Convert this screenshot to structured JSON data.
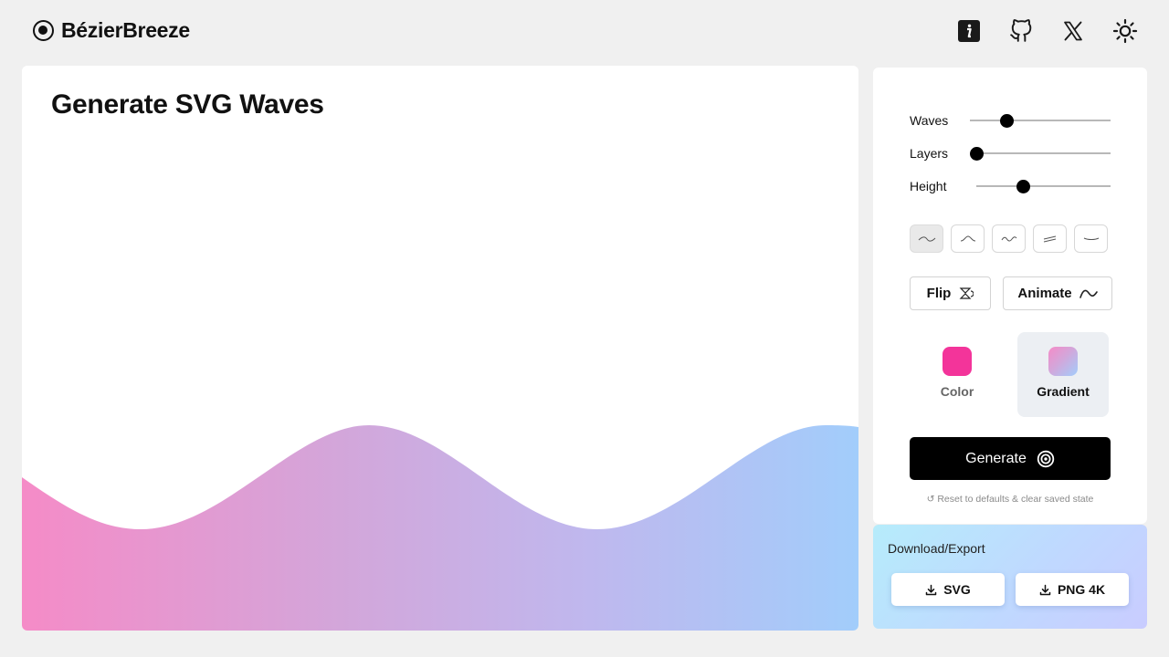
{
  "brand": {
    "name": "BézierBreeze",
    "logo_icon": "target-logo-icon"
  },
  "header_icons": [
    "info-icon",
    "github-icon",
    "x-twitter-icon",
    "sun-theme-icon"
  ],
  "canvas": {
    "title": "Generate SVG Waves",
    "gradient_colors": [
      "#f58bc7",
      "#d3a6da",
      "#bfb8ee",
      "#a2cdfb"
    ]
  },
  "controls": {
    "sliders": [
      {
        "label": "Waves",
        "value_fraction": 0.26
      },
      {
        "label": "Layers",
        "value_fraction": 0.0
      },
      {
        "label": "Height",
        "value_fraction": 0.35
      }
    ],
    "shapes": [
      {
        "name": "smooth-wave-icon",
        "active": true
      },
      {
        "name": "peak-wave-icon",
        "active": false
      },
      {
        "name": "zigzag-wave-icon",
        "active": false
      },
      {
        "name": "layered-lines-icon",
        "active": false
      },
      {
        "name": "curve-dip-icon",
        "active": false
      }
    ],
    "flip_label": "Flip",
    "animate_label": "Animate",
    "fill_options": [
      {
        "label": "Color",
        "color": "#f3349a",
        "active": false
      },
      {
        "label": "Gradient",
        "color": "gradient",
        "active": true
      }
    ],
    "generate_label": "Generate",
    "reset_label": "↺ Reset to defaults & clear saved state"
  },
  "export": {
    "title": "Download/Export",
    "buttons": [
      "SVG",
      "PNG 4K"
    ]
  }
}
